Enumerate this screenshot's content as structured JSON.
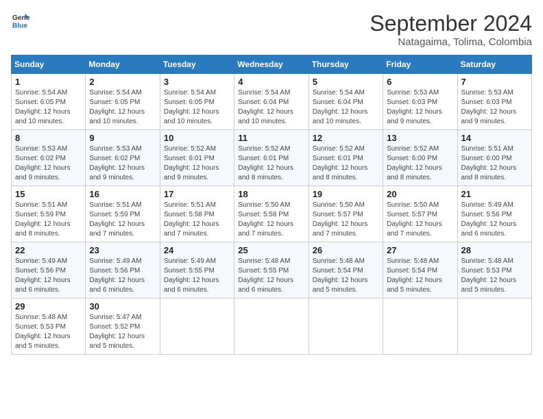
{
  "logo": {
    "line1": "General",
    "line2": "Blue"
  },
  "title": "September 2024",
  "location": "Natagaima, Tolima, Colombia",
  "weekdays": [
    "Sunday",
    "Monday",
    "Tuesday",
    "Wednesday",
    "Thursday",
    "Friday",
    "Saturday"
  ],
  "weeks": [
    [
      {
        "day": "1",
        "sunrise": "5:54 AM",
        "sunset": "6:05 PM",
        "daylight": "12 hours and 10 minutes."
      },
      {
        "day": "2",
        "sunrise": "5:54 AM",
        "sunset": "6:05 PM",
        "daylight": "12 hours and 10 minutes."
      },
      {
        "day": "3",
        "sunrise": "5:54 AM",
        "sunset": "6:05 PM",
        "daylight": "12 hours and 10 minutes."
      },
      {
        "day": "4",
        "sunrise": "5:54 AM",
        "sunset": "6:04 PM",
        "daylight": "12 hours and 10 minutes."
      },
      {
        "day": "5",
        "sunrise": "5:54 AM",
        "sunset": "6:04 PM",
        "daylight": "12 hours and 10 minutes."
      },
      {
        "day": "6",
        "sunrise": "5:53 AM",
        "sunset": "6:03 PM",
        "daylight": "12 hours and 9 minutes."
      },
      {
        "day": "7",
        "sunrise": "5:53 AM",
        "sunset": "6:03 PM",
        "daylight": "12 hours and 9 minutes."
      }
    ],
    [
      {
        "day": "8",
        "sunrise": "5:53 AM",
        "sunset": "6:02 PM",
        "daylight": "12 hours and 9 minutes."
      },
      {
        "day": "9",
        "sunrise": "5:53 AM",
        "sunset": "6:02 PM",
        "daylight": "12 hours and 9 minutes."
      },
      {
        "day": "10",
        "sunrise": "5:52 AM",
        "sunset": "6:01 PM",
        "daylight": "12 hours and 9 minutes."
      },
      {
        "day": "11",
        "sunrise": "5:52 AM",
        "sunset": "6:01 PM",
        "daylight": "12 hours and 8 minutes."
      },
      {
        "day": "12",
        "sunrise": "5:52 AM",
        "sunset": "6:01 PM",
        "daylight": "12 hours and 8 minutes."
      },
      {
        "day": "13",
        "sunrise": "5:52 AM",
        "sunset": "6:00 PM",
        "daylight": "12 hours and 8 minutes."
      },
      {
        "day": "14",
        "sunrise": "5:51 AM",
        "sunset": "6:00 PM",
        "daylight": "12 hours and 8 minutes."
      }
    ],
    [
      {
        "day": "15",
        "sunrise": "5:51 AM",
        "sunset": "5:59 PM",
        "daylight": "12 hours and 8 minutes."
      },
      {
        "day": "16",
        "sunrise": "5:51 AM",
        "sunset": "5:59 PM",
        "daylight": "12 hours and 7 minutes."
      },
      {
        "day": "17",
        "sunrise": "5:51 AM",
        "sunset": "5:58 PM",
        "daylight": "12 hours and 7 minutes."
      },
      {
        "day": "18",
        "sunrise": "5:50 AM",
        "sunset": "5:58 PM",
        "daylight": "12 hours and 7 minutes."
      },
      {
        "day": "19",
        "sunrise": "5:50 AM",
        "sunset": "5:57 PM",
        "daylight": "12 hours and 7 minutes."
      },
      {
        "day": "20",
        "sunrise": "5:50 AM",
        "sunset": "5:57 PM",
        "daylight": "12 hours and 7 minutes."
      },
      {
        "day": "21",
        "sunrise": "5:49 AM",
        "sunset": "5:56 PM",
        "daylight": "12 hours and 6 minutes."
      }
    ],
    [
      {
        "day": "22",
        "sunrise": "5:49 AM",
        "sunset": "5:56 PM",
        "daylight": "12 hours and 6 minutes."
      },
      {
        "day": "23",
        "sunrise": "5:49 AM",
        "sunset": "5:56 PM",
        "daylight": "12 hours and 6 minutes."
      },
      {
        "day": "24",
        "sunrise": "5:49 AM",
        "sunset": "5:55 PM",
        "daylight": "12 hours and 6 minutes."
      },
      {
        "day": "25",
        "sunrise": "5:48 AM",
        "sunset": "5:55 PM",
        "daylight": "12 hours and 6 minutes."
      },
      {
        "day": "26",
        "sunrise": "5:48 AM",
        "sunset": "5:54 PM",
        "daylight": "12 hours and 5 minutes."
      },
      {
        "day": "27",
        "sunrise": "5:48 AM",
        "sunset": "5:54 PM",
        "daylight": "12 hours and 5 minutes."
      },
      {
        "day": "28",
        "sunrise": "5:48 AM",
        "sunset": "5:53 PM",
        "daylight": "12 hours and 5 minutes."
      }
    ],
    [
      {
        "day": "29",
        "sunrise": "5:48 AM",
        "sunset": "5:53 PM",
        "daylight": "12 hours and 5 minutes."
      },
      {
        "day": "30",
        "sunrise": "5:47 AM",
        "sunset": "5:52 PM",
        "daylight": "12 hours and 5 minutes."
      },
      null,
      null,
      null,
      null,
      null
    ]
  ]
}
